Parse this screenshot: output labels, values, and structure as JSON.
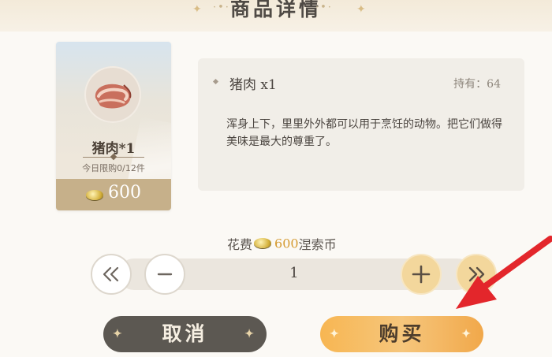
{
  "header": {
    "title": "商品详情"
  },
  "item": {
    "icon": "pork-meat-icon",
    "name": "猪肉*1",
    "limit": "今日限购0/12件",
    "price": "600"
  },
  "description": {
    "name": "猪肉 x1",
    "held": "持有：64",
    "text": "浑身上下，里里外外都可以用于烹饪的动物。把它们做得美味是最大的尊重了。"
  },
  "cost": {
    "prefix": "花费",
    "amount": "600",
    "currency": "涅索币"
  },
  "quantity": {
    "value": "1"
  },
  "buttons": {
    "cancel": "取消",
    "buy": "购买"
  },
  "colors": {
    "accent_gold": "#f3d79c",
    "buy_orange": "#f7b652",
    "cancel_dark": "#5c5852",
    "annotation_red": "#e3262b"
  }
}
